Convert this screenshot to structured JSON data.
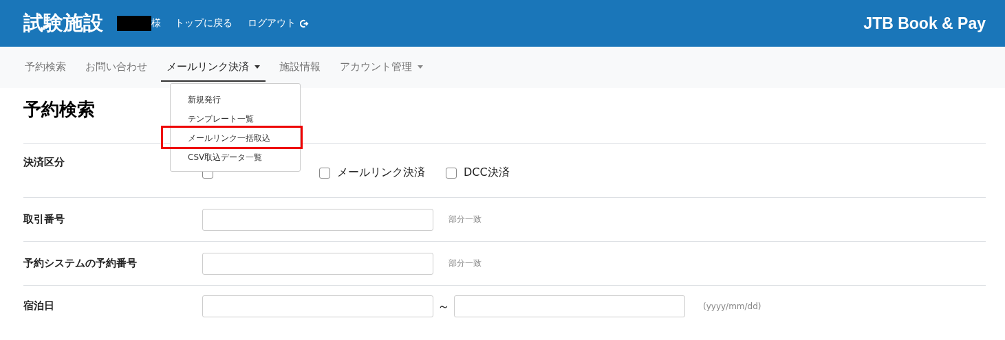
{
  "header": {
    "title": "試験施設",
    "user_suffix": "様",
    "links": [
      {
        "label": "トップに戻る",
        "icon": false
      },
      {
        "label": "ログアウト",
        "icon": true
      }
    ],
    "logo": "JTB Book & Pay"
  },
  "nav": [
    {
      "label": "予約検索",
      "selected": false,
      "caret": false
    },
    {
      "label": "お問い合わせ",
      "selected": false,
      "caret": false
    },
    {
      "label": "メールリンク決済",
      "selected": true,
      "caret": true
    },
    {
      "label": "施設情報",
      "selected": false,
      "caret": false
    },
    {
      "label": "アカウント管理",
      "selected": false,
      "caret": true
    }
  ],
  "dropdown": [
    {
      "label": "新規発行",
      "highlighted": false
    },
    {
      "label": "テンプレート一覧",
      "highlighted": false
    },
    {
      "label": "メールリンク一括取込",
      "highlighted": true
    },
    {
      "label": "CSV取込データ一覧",
      "highlighted": false
    }
  ],
  "page_title": "予約検索",
  "form": [
    {
      "kind": "checkboxes",
      "label": "決済区分",
      "options": [
        {
          "checked": false
        },
        {
          "label": "メールリンク決済",
          "checked": false
        },
        {
          "label": "DCC決済",
          "checked": false
        }
      ]
    },
    {
      "kind": "text",
      "label": "取引番号",
      "hint": "部分一致"
    },
    {
      "kind": "text",
      "label": "予約システムの予約番号",
      "hint": "部分一致"
    },
    {
      "kind": "range",
      "label": "宿泊日",
      "separator": "～",
      "hint": "(yyyy/mm/dd)"
    }
  ]
}
